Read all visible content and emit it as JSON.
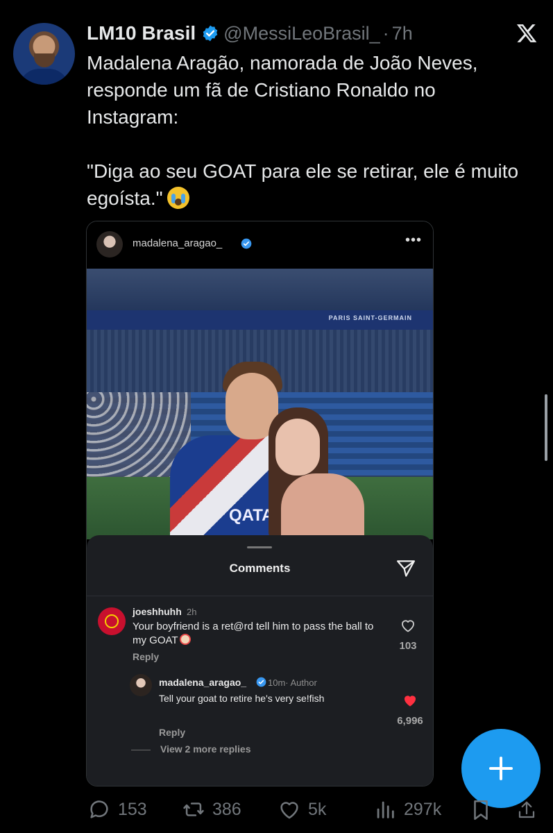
{
  "tweet": {
    "author_name": "LM10 Brasil",
    "handle": "@MessiLeoBrasil_",
    "time": "7h",
    "text": "Madalena Aragão, namorada de João Neves, responde um fã de Cristiano Ronaldo no Instagram:\n\n\"Diga ao seu GOAT para ele se retirar, ele é muito egoísta.\"",
    "emoji": "loudly-crying-face-icon"
  },
  "embed": {
    "username": "madalena_aragao_",
    "banner_text": "PARIS SAINT-GERMAIN",
    "shirt_text": "QATAR",
    "comments_title": "Comments",
    "comments": [
      {
        "user": "joeshhuhh",
        "time": "2h",
        "text": "Your boyfriend is a ret@rd tell him to pass the ball to my GOAT",
        "reply": "Reply",
        "likes": "103"
      },
      {
        "user": "madalena_aragao_",
        "time": "10m· Author",
        "text": "Tell your goat to retire he's very se!fish",
        "reply": "Reply",
        "likes": "6,996",
        "view_more": "View 2 more replies"
      }
    ]
  },
  "actions": {
    "replies": "153",
    "retweets": "386",
    "likes": "5k",
    "views": "297k"
  },
  "colors": {
    "background": "#000000",
    "accent": "#1d9bf0",
    "heart_liked": "#ff3040",
    "muted": "#71767b"
  }
}
